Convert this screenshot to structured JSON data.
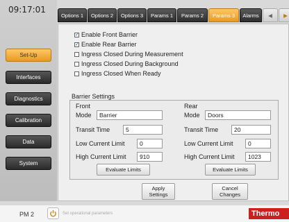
{
  "clock": "09:17:01",
  "tabs": [
    "Options 1",
    "Options 2",
    "Options 3",
    "Params 1",
    "Params 2",
    "Params 3",
    "Alarms"
  ],
  "active_tab": "Params 3",
  "sidebar": {
    "items": [
      "Set-Up",
      "Interfaces",
      "Diagnostics",
      "Calibration",
      "Data",
      "System"
    ],
    "active": "Set-Up"
  },
  "options": [
    {
      "label": "Enable Front Barrier",
      "checked": true
    },
    {
      "label": "Enable Rear Barrier",
      "checked": true
    },
    {
      "label": "Ingress Closed During Measurement",
      "checked": false
    },
    {
      "label": "Ingress Closed During Background",
      "checked": false
    },
    {
      "label": "Ingress Closed When Ready",
      "checked": false
    }
  ],
  "barrier_settings": {
    "title": "Barrier Settings",
    "front": {
      "title": "Front",
      "mode_label": "Mode",
      "mode": "Barrier",
      "transit_label": "Transit Time",
      "transit": "5",
      "low_label": "Low Current Limit",
      "low": "0",
      "high_label": "High Current Limit",
      "high": "910",
      "evaluate": "Evaluate Limits"
    },
    "rear": {
      "title": "Rear",
      "mode_label": "Mode",
      "mode": "Doors",
      "transit_label": "Transit Time",
      "transit": "20",
      "low_label": "Low Current Limit",
      "low": "0",
      "high_label": "High Current Limit",
      "high": "1023",
      "evaluate": "Evaluate Limits"
    }
  },
  "apply_line1": "Apply",
  "apply_line2": "Settings",
  "cancel_line1": "Cancel",
  "cancel_line2": "Changes",
  "status": {
    "device": "PM 2",
    "hint": "Set operational parameters",
    "brand": "Thermo"
  },
  "colors": {
    "accent": "#f0a636",
    "brand_red": "#cc1f1f"
  }
}
